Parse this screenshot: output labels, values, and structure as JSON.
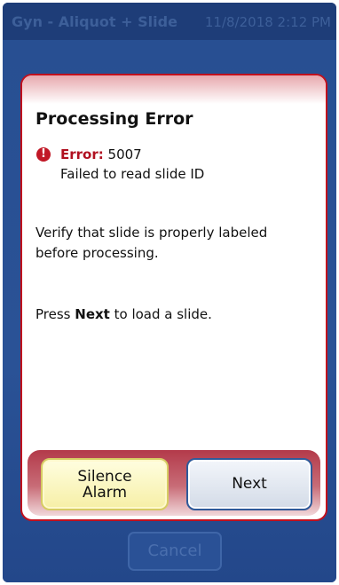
{
  "header": {
    "title": "Gyn - Aliquot + Slide",
    "datetime": "11/8/2018 2:12 PM"
  },
  "background": {
    "cancel_label": "Cancel"
  },
  "dialog": {
    "title": "Processing Error",
    "error_label": "Error:",
    "error_code": "5007",
    "error_description": "Failed to read slide ID",
    "instruction": "Verify that slide is properly labeled before processing.",
    "press_prefix": "Press",
    "press_keyword": "Next",
    "press_suffix": "to load a slide.",
    "silence_line1": "Silence",
    "silence_line2": "Alarm",
    "next_label": "Next",
    "error_icon_glyph": "!"
  },
  "colors": {
    "screen_bg": "#23478a",
    "dialog_border": "#c1101d",
    "error_text": "#b01020",
    "silence_button": "#f6efa6",
    "next_button_border": "#2f5a9a"
  },
  "icons": {
    "error": "error-exclamation-icon"
  }
}
